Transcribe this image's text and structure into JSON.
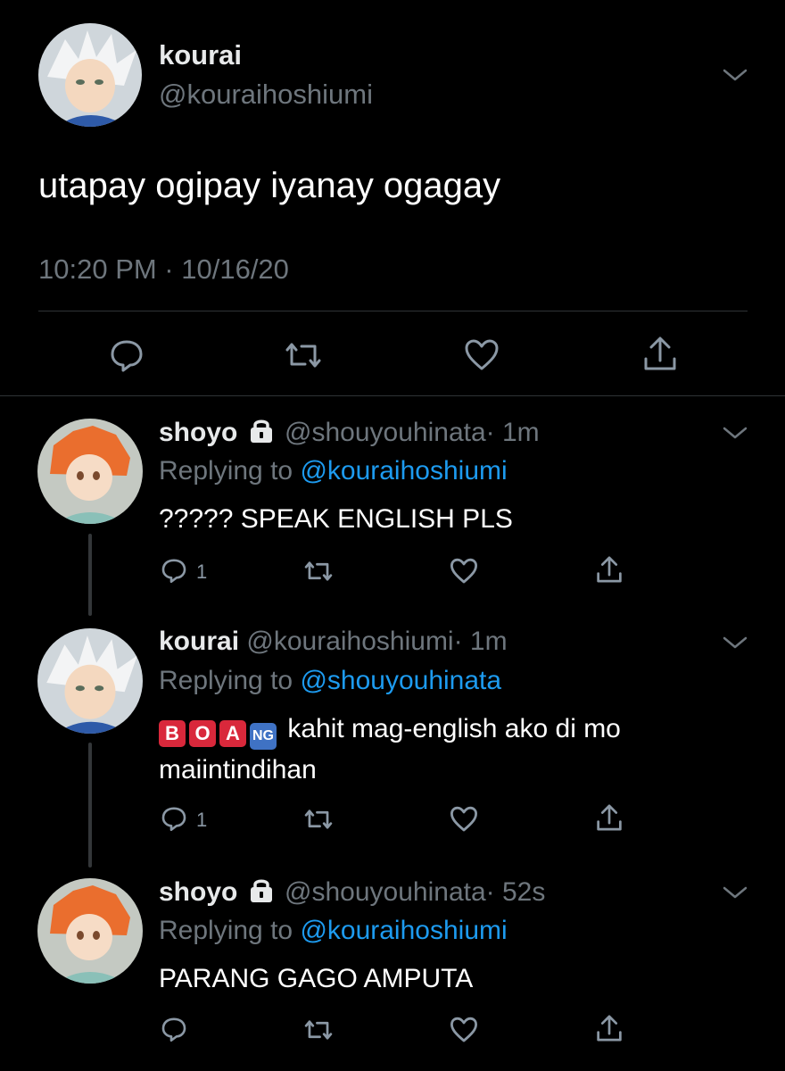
{
  "main_tweet": {
    "name": "kourai",
    "handle": "@kouraihoshiumi",
    "text": "utapay ogipay iyanay ogagay",
    "timestamp": "10:20 PM · 10/16/20"
  },
  "replies": [
    {
      "name": "shoyo",
      "handle": "@shouyouhinata",
      "time": "· 1m",
      "replying_prefix": "Replying to",
      "replying_to": "@kouraihoshiumi",
      "text": "????? SPEAK ENGLISH PLS",
      "reply_count": "1"
    },
    {
      "name": "kourai",
      "handle": "@kouraihoshiumi",
      "time": "· 1m",
      "replying_prefix": "Replying to",
      "replying_to": "@shouyouhinata",
      "emoji_letters": [
        "B",
        "O",
        "A",
        "NG"
      ],
      "text_line1": "kahit mag-english ako di mo",
      "text_line2": "maiintindihan",
      "reply_count": "1"
    },
    {
      "name": "shoyo",
      "handle": "@shouyouhinata",
      "time": "· 52s",
      "replying_prefix": "Replying to",
      "replying_to": "@kouraihoshiumi",
      "text": "PARANG GAGO AMPUTA"
    }
  ],
  "colors": {
    "background": "#000000",
    "link": "#1d9bf0",
    "muted": "#6e767d",
    "emoji_red": "#d9283b",
    "emoji_blue": "#3f72c4"
  },
  "icons": [
    "chevron-down-icon",
    "reply-icon",
    "retweet-icon",
    "like-icon",
    "share-icon",
    "lock-icon"
  ]
}
